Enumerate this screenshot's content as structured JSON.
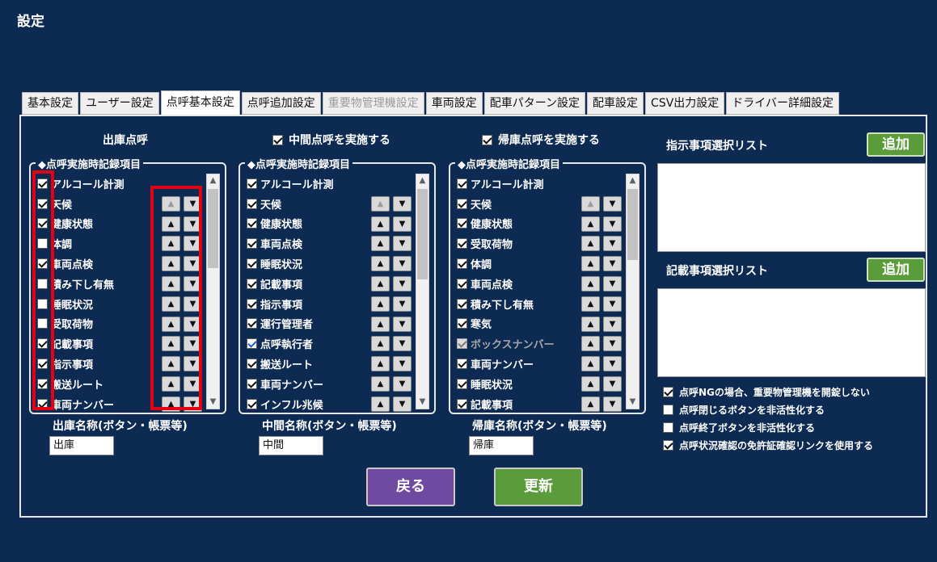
{
  "window_title": "設定",
  "tabs": [
    {
      "label": "基本設定",
      "active": false,
      "disabled": false
    },
    {
      "label": "ユーザー設定",
      "active": false,
      "disabled": false
    },
    {
      "label": "点呼基本設定",
      "active": true,
      "disabled": false
    },
    {
      "label": "点呼追加設定",
      "active": false,
      "disabled": false
    },
    {
      "label": "重要物管理機設定",
      "active": false,
      "disabled": true
    },
    {
      "label": "車両設定",
      "active": false,
      "disabled": false
    },
    {
      "label": "配車パターン設定",
      "active": false,
      "disabled": false
    },
    {
      "label": "配車設定",
      "active": false,
      "disabled": false
    },
    {
      "label": "CSV出力設定",
      "active": false,
      "disabled": false
    },
    {
      "label": "ドライバー詳細設定",
      "active": false,
      "disabled": false
    }
  ],
  "sections": [
    {
      "key": "departure",
      "header": "出庫点呼",
      "header_checkbox": false,
      "header_checked": false,
      "legend": "◆点呼実施時記録項目",
      "items": [
        {
          "label": "アルコール計測",
          "checked": true,
          "style": "normal",
          "up_enabled": false,
          "no_arrows": true
        },
        {
          "label": "天候",
          "checked": true,
          "style": "normal",
          "up_enabled": false
        },
        {
          "label": "健康状態",
          "checked": true,
          "style": "normal",
          "up_enabled": true
        },
        {
          "label": "体調",
          "checked": false,
          "style": "normal",
          "up_enabled": true
        },
        {
          "label": "車両点検",
          "checked": true,
          "style": "normal",
          "up_enabled": true
        },
        {
          "label": "積み下し有無",
          "checked": false,
          "style": "normal",
          "up_enabled": true
        },
        {
          "label": "睡眠状況",
          "checked": false,
          "style": "normal",
          "up_enabled": true
        },
        {
          "label": "受取荷物",
          "checked": false,
          "style": "normal",
          "up_enabled": true
        },
        {
          "label": "記載事項",
          "checked": true,
          "style": "normal",
          "up_enabled": true
        },
        {
          "label": "指示事項",
          "checked": true,
          "style": "normal",
          "up_enabled": true
        },
        {
          "label": "搬送ルート",
          "checked": true,
          "style": "normal",
          "up_enabled": true
        },
        {
          "label": "車両ナンバー",
          "checked": true,
          "style": "normal",
          "up_enabled": true
        }
      ],
      "name_label": "出庫名称(ボタン・帳票等)",
      "name_value": "出庫"
    },
    {
      "key": "middle",
      "header": "中間点呼を実施する",
      "header_checkbox": true,
      "header_checked": true,
      "legend": "◆点呼実施時記録項目",
      "items": [
        {
          "label": "アルコール計測",
          "checked": true,
          "style": "normal",
          "up_enabled": false,
          "no_arrows": true
        },
        {
          "label": "天候",
          "checked": true,
          "style": "normal",
          "up_enabled": false
        },
        {
          "label": "健康状態",
          "checked": true,
          "style": "normal",
          "up_enabled": true
        },
        {
          "label": "車両点検",
          "checked": true,
          "style": "normal",
          "up_enabled": true
        },
        {
          "label": "睡眠状況",
          "checked": true,
          "style": "normal",
          "up_enabled": true
        },
        {
          "label": "記載事項",
          "checked": true,
          "style": "normal",
          "up_enabled": true
        },
        {
          "label": "指示事項",
          "checked": true,
          "style": "normal",
          "up_enabled": true
        },
        {
          "label": "運行管理者",
          "checked": true,
          "style": "normal",
          "up_enabled": true
        },
        {
          "label": "点呼執行者",
          "checked": true,
          "style": "blue",
          "up_enabled": true
        },
        {
          "label": "搬送ルート",
          "checked": true,
          "style": "normal",
          "up_enabled": true
        },
        {
          "label": "車両ナンバー",
          "checked": true,
          "style": "normal",
          "up_enabled": true
        },
        {
          "label": "インフル兆候",
          "checked": true,
          "style": "normal",
          "up_enabled": true
        }
      ],
      "name_label": "中間名称(ボタン・帳票等)",
      "name_value": "中間"
    },
    {
      "key": "return",
      "header": "帰庫点呼を実施する",
      "header_checkbox": true,
      "header_checked": true,
      "legend": "◆点呼実施時記録項目",
      "items": [
        {
          "label": "アルコール計測",
          "checked": true,
          "style": "normal",
          "up_enabled": false,
          "no_arrows": true
        },
        {
          "label": "天候",
          "checked": true,
          "style": "normal",
          "up_enabled": false
        },
        {
          "label": "健康状態",
          "checked": true,
          "style": "normal",
          "up_enabled": true
        },
        {
          "label": "受取荷物",
          "checked": true,
          "style": "normal",
          "up_enabled": true
        },
        {
          "label": "体調",
          "checked": true,
          "style": "normal",
          "up_enabled": true
        },
        {
          "label": "車両点検",
          "checked": true,
          "style": "normal",
          "up_enabled": true
        },
        {
          "label": "積み下し有無",
          "checked": true,
          "style": "normal",
          "up_enabled": true
        },
        {
          "label": "寒気",
          "checked": true,
          "style": "normal",
          "up_enabled": true
        },
        {
          "label": "ボックスナンバー",
          "checked": true,
          "style": "gray",
          "up_enabled": true
        },
        {
          "label": "車両ナンバー",
          "checked": true,
          "style": "normal",
          "up_enabled": true
        },
        {
          "label": "睡眠状況",
          "checked": true,
          "style": "normal",
          "up_enabled": true
        },
        {
          "label": "記載事項",
          "checked": true,
          "style": "normal",
          "up_enabled": true
        }
      ],
      "name_label": "帰庫名称(ボタン・帳票等)",
      "name_value": "帰庫"
    }
  ],
  "instruction_list": {
    "title": "指示事項選択リスト",
    "add_label": "追加"
  },
  "entry_list": {
    "title": "記載事項選択リスト",
    "add_label": "追加"
  },
  "options": [
    {
      "label": "点呼NGの場合、重要物管理機を開錠しない",
      "checked": true
    },
    {
      "label": "点呼閉じるボタンを非活性化する",
      "checked": false
    },
    {
      "label": "点呼終了ボタンを非活性化する",
      "checked": false
    },
    {
      "label": "点呼状況確認の免許証確認リンクを使用する",
      "checked": true
    }
  ],
  "buttons": {
    "back": "戻る",
    "update": "更新"
  },
  "icons": {
    "up": "triangle-up-icon",
    "down": "triangle-down-icon"
  },
  "colors": {
    "background": "#0d2a52",
    "highlight": "#e50012",
    "add_button": "#5a9b3a",
    "back_button": "#6f4aa0"
  }
}
